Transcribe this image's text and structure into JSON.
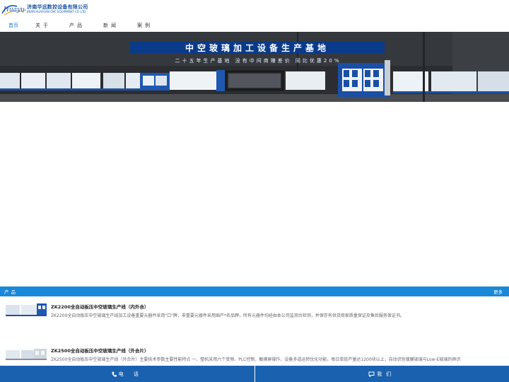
{
  "header": {
    "logo_script": "Huayuan",
    "company_cn": "济南华远数控设备有限公司",
    "company_en": "JINAN HUAYUAN CNC EQUIPMENT CO.,LTD."
  },
  "nav": {
    "items": [
      "首页",
      "关于",
      "产品",
      "新闻",
      "案例"
    ]
  },
  "banner": {
    "title": "中空玻璃加工设备生产基地",
    "subtitle": "二十五年生产基地 没有中间商赚差价 同比优惠20%"
  },
  "products_section": {
    "title": "产品",
    "more": "更多",
    "items": [
      {
        "name": "ZK2200全自动板压中空玻璃生产线（内外合）",
        "desc": "ZK2200全自动板压中空玻璃生产线加工设备重要元器件采用\"口\"牌，非重要元器件采用国产*名品牌，所有元器件均经由本公司监测台检测，并保存有供货商家质量保证及售后服务保证书。"
      },
      {
        "name": "ZK2500全自动板压中空玻璃生产线（外合片）",
        "desc": "ZK2500全自动板压中空玻璃生产线（外合片）主要技术参数主要性能特点 一、整机采用六个变频、PLC控制，触摸屏操作，设备多道运转优化功能。每日单班产量达1200块以上，自动识别镀膜玻璃与Low-E玻璃的辨识"
      }
    ]
  },
  "bottom_bar": {
    "phone": "电 话",
    "contact": "我们"
  },
  "colors": {
    "accent": "#1a88d8",
    "nav_active": "#1a7bd2",
    "bottom_bar": "#1a62b0",
    "banner_title_bg": "#0a3a8a"
  }
}
